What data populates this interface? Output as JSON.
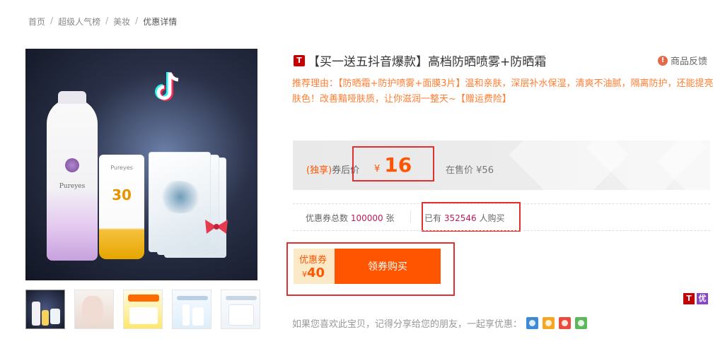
{
  "breadcrumb": {
    "items": [
      "首页",
      "超级人气榜",
      "美妆",
      "优惠详情"
    ],
    "separator": "/"
  },
  "product": {
    "store_badge": "T",
    "title": "【买一送五抖音爆款】高档防晒喷雾+防晒霜",
    "feedback_label": "商品反馈",
    "reason_text": "推荐理由：【防晒霜+防护喷雾+面膜3片】温和亲肤，深层补水保湿，清爽不油腻，隔离防护，还能提亮肤色！改善黯哑肤质，让你滋润一整天~【赠运费险】",
    "image_brand": "Pureyes",
    "image_spf": "30"
  },
  "price": {
    "exclusive_label": "(独享)",
    "coupon_after_label": "券后价",
    "currency": "¥",
    "coupon_price": "16",
    "on_sale_label": "在售价",
    "on_sale_price": "¥56"
  },
  "stats": {
    "coupon_total_label": "优惠券总数",
    "coupon_total": "100000",
    "coupon_unit": "张",
    "bought_prefix": "已有",
    "bought_count": "352546",
    "bought_suffix": "人购买"
  },
  "coupon": {
    "label": "优惠券",
    "currency": "¥",
    "value": "40",
    "button_label": "领券购买"
  },
  "tags": {
    "tmall": "T",
    "you": "优"
  },
  "share": {
    "text": "如果您喜欢此宝贝，记得分享给您的朋友，一起享优惠："
  },
  "colors": {
    "accent": "#ff5500",
    "reason": "#ff7d32",
    "highlight": "#e03030",
    "count": "#c01a5a"
  }
}
